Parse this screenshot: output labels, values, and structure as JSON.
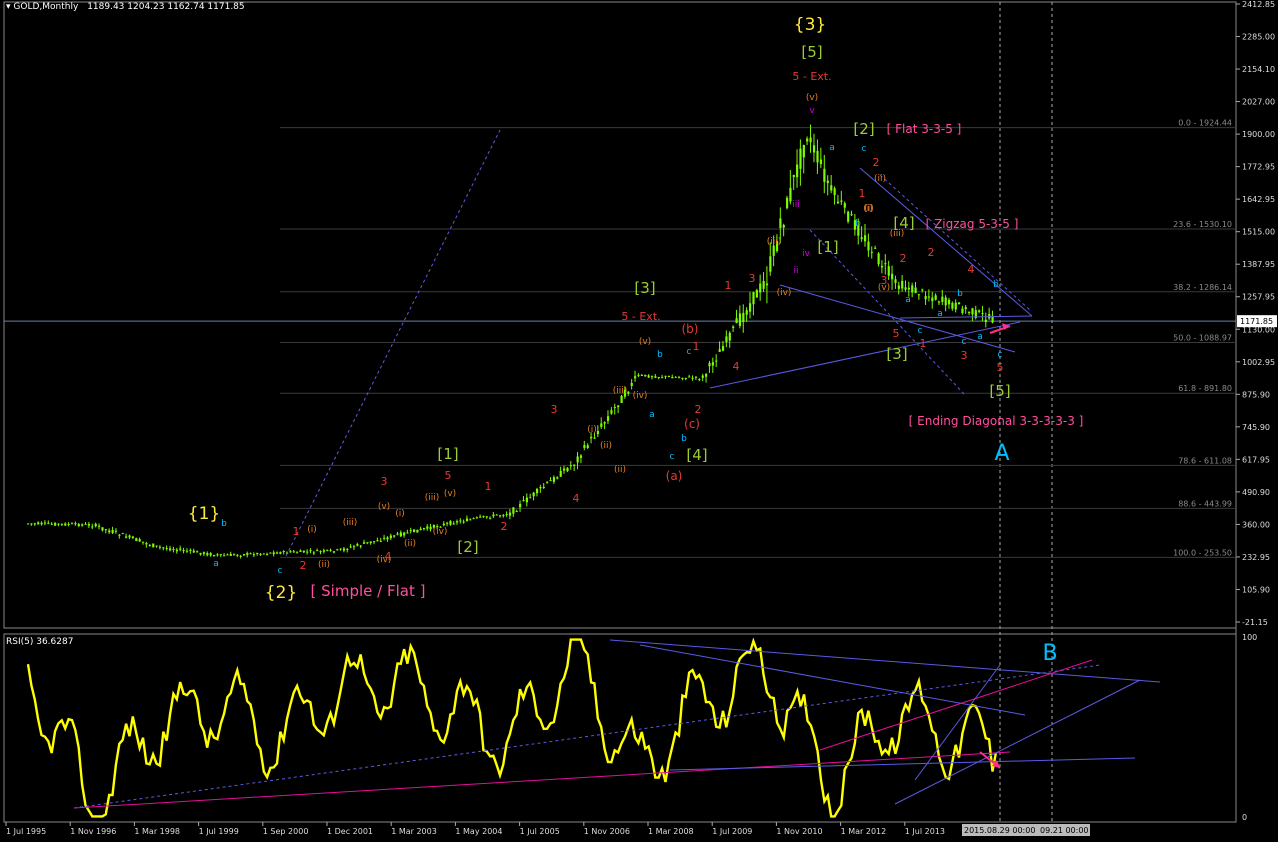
{
  "main_title": {
    "symbol": "GOLD,Monthly",
    "ohlc": "1189.43 1204.23 1162.74 1171.85"
  },
  "rsi_title": "RSI(5) 36.6287",
  "current_price_label": "1171.85",
  "x_axis_labels": [
    "1 Jul 1995",
    "1 Nov 1996",
    "1 Mar 1998",
    "1 Jul 1999",
    "1 Sep 2000",
    "1 Dec 2001",
    "1 Mar 2003",
    "1 May 2004",
    "1 Jul 2005",
    "1 Nov 2006",
    "1 Mar 2008",
    "1 Jul 2009",
    "1 Nov 2010",
    "1 Mar 2012",
    "1 Jul 2013"
  ],
  "x_axis_cursor_labels": [
    "2015.08.29 00:00",
    "09.21 00:00"
  ],
  "price_axis_labels": [
    "2412.85",
    "2285.00",
    "2154.10",
    "2027.00",
    "1900.00",
    "1772.95",
    "1642.95",
    "1515.00",
    "1387.95",
    "1257.95",
    "1130.00",
    "1002.95",
    "875.90",
    "745.90",
    "617.95",
    "490.90",
    "360.00",
    "232.95",
    "105.90",
    "-21.15"
  ],
  "rsi_axis_labels": [
    "100",
    "0"
  ],
  "fib_levels": [
    {
      "label": "0.0 - 1924.44"
    },
    {
      "label": "23.6 - 1530.10"
    },
    {
      "label": "38.2 - 1286.14"
    },
    {
      "label": "50.0 - 1088.97"
    },
    {
      "label": "61.8 - 891.80"
    },
    {
      "label": "78.6 - 611.08"
    },
    {
      "label": "88.6 - 443.99"
    },
    {
      "label": "100.0 - 253.50"
    }
  ],
  "wave_labels": [
    "{3}",
    "[5]",
    "5 - Ext.",
    "(v)",
    "v",
    "[2]",
    "[ Flat 3-3-5 ]",
    "c",
    "a",
    "2",
    "iii",
    "iv",
    "ii",
    "[1]",
    "[4]",
    "[ Zigzag 5-3-5 ]",
    "(i)",
    "(ii)",
    "(iii)",
    "(iv)",
    "(v)",
    "1",
    "3",
    "4",
    "b",
    "[3]",
    "[5]",
    "[ Ending Diagonal 3-3-3-3-3 ]",
    "(b)",
    "(c)",
    "(a)",
    "[4]",
    "{1}",
    "{2}",
    "[ Simple / Flat ]",
    "[1]",
    "[2]"
  ],
  "annotation_letters": [
    "A",
    "B"
  ],
  "colors": {
    "background": "#000000",
    "candles": "#7CFC00",
    "rsi_line": "#FFFF00",
    "trendline": "#5A5AE6",
    "magenta": "#E0109A",
    "fib_line": "#303030",
    "label_yellow": "#FFEB3B",
    "label_green": "#9ACD32",
    "label_red": "#E53935",
    "label_orange": "#E67E22",
    "label_cyan": "#00BFFF",
    "label_pink": "#FF4FA0",
    "label_purple": "#D000E0"
  },
  "chart_data": {
    "type": "line",
    "instrument": "GOLD",
    "timeframe": "Monthly",
    "price_series": {
      "x": [
        "1995-07",
        "1996-11",
        "1998-03",
        "1999-07",
        "2000-09",
        "2001-12",
        "2003-03",
        "2004-05",
        "2005-07",
        "2006-11",
        "2008-03",
        "2009-07",
        "2010-11",
        "2011-09",
        "2012-03",
        "2013-07",
        "2015-08"
      ],
      "y": [
        385,
        380,
        295,
        260,
        272,
        278,
        340,
        390,
        425,
        620,
        960,
        950,
        1340,
        1900,
        1680,
        1320,
        1172
      ]
    },
    "ylim": [
      -21.15,
      2412.85
    ],
    "rsi": {
      "name": "RSI(5)",
      "last": 36.6287,
      "ylim": [
        0,
        100
      ],
      "x": [
        "1995-07",
        "1996-11",
        "1998-03",
        "1999-07",
        "2000-09",
        "2001-12",
        "2003-03",
        "2004-05",
        "2005-07",
        "2006-11",
        "2008-03",
        "2009-07",
        "2010-11",
        "2012-03",
        "2013-07",
        "2015-08"
      ],
      "y": [
        78,
        8,
        52,
        62,
        45,
        70,
        75,
        60,
        42,
        88,
        28,
        65,
        82,
        20,
        58,
        36.6
      ]
    }
  }
}
